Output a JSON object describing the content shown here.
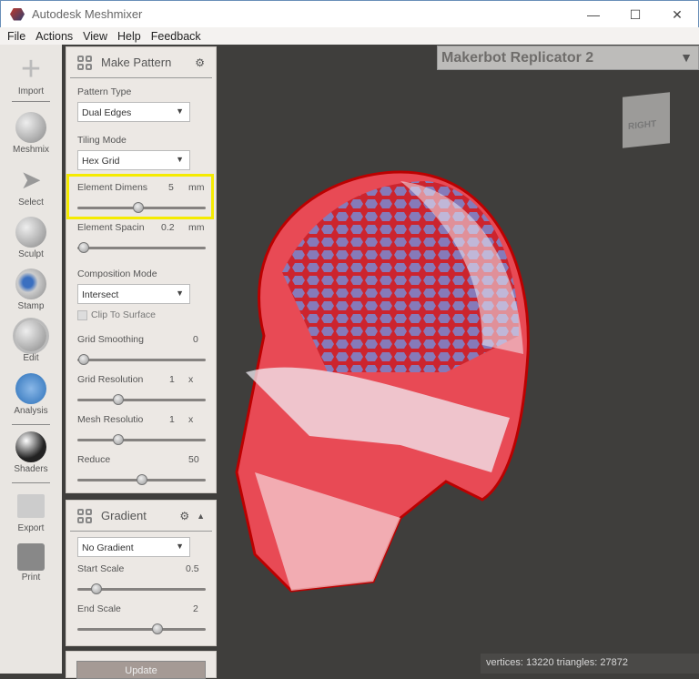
{
  "window": {
    "title": "Autodesk Meshmixer",
    "minimize": "—",
    "maximize": "☐",
    "close": "✕"
  },
  "menu": [
    "File",
    "Actions",
    "View",
    "Help",
    "Feedback"
  ],
  "tools": [
    "Import",
    "Meshmix",
    "Select",
    "Sculpt",
    "Stamp",
    "Edit",
    "Analysis",
    "Shaders",
    "Export",
    "Print"
  ],
  "make_pattern": {
    "title": "Make Pattern",
    "pattern_type_label": "Pattern Type",
    "pattern_type": "Dual Edges",
    "tiling_mode_label": "Tiling Mode",
    "tiling_mode": "Hex Grid",
    "element_dimens": {
      "label": "Element Dimens",
      "value": "5",
      "unit": "mm",
      "fraction": 0.47
    },
    "element_spacing": {
      "label": "Element Spacin",
      "value": "0.2",
      "unit": "mm",
      "fraction": 0.02
    },
    "composition_mode_label": "Composition Mode",
    "composition_mode": "Intersect",
    "clip_to_surface": {
      "label": "Clip To Surface",
      "checked": false
    },
    "grid_smoothing": {
      "label": "Grid Smoothing",
      "value": "0",
      "fraction": 0.02
    },
    "grid_resolution": {
      "label": "Grid Resolution",
      "value": "1",
      "unit": "x",
      "fraction": 0.31
    },
    "mesh_resolution": {
      "label": "Mesh Resolutio",
      "value": "1",
      "unit": "x",
      "fraction": 0.31
    },
    "reduce": {
      "label": "Reduce",
      "value": "50",
      "fraction": 0.5
    }
  },
  "gradient": {
    "title": "Gradient",
    "mode": "No Gradient",
    "start_scale": {
      "label": "Start Scale",
      "value": "0.5",
      "fraction": 0.13
    },
    "end_scale": {
      "label": "End Scale",
      "value": "2",
      "fraction": 0.63
    }
  },
  "update_label": "Update",
  "printer": "Makerbot Replicator 2",
  "cube_face": "RIGHT",
  "status": "vertices: 13220 triangles: 27872"
}
